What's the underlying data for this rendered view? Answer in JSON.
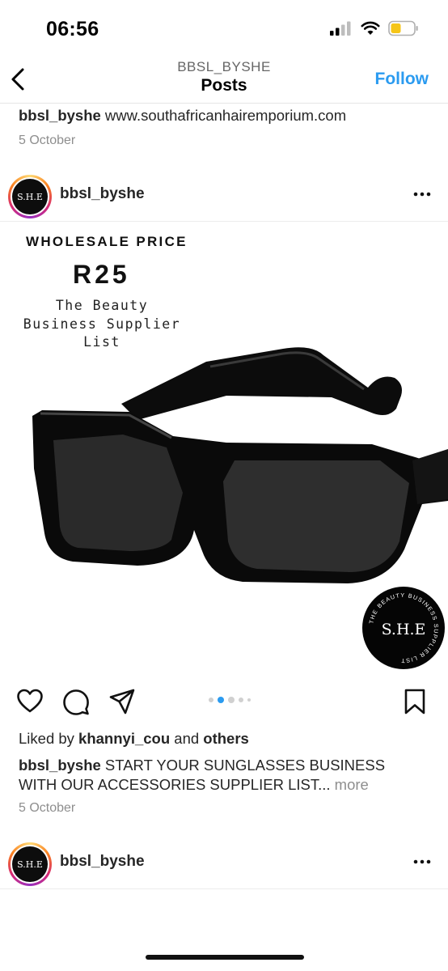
{
  "status_bar": {
    "time": "06:56"
  },
  "header": {
    "username": "BBSL_BYSHE",
    "title": "Posts",
    "follow_label": "Follow"
  },
  "previous_post": {
    "caption_user": "bbsl_byshe",
    "caption_text": " www.southafricanhairemporium.com",
    "date": "5 October"
  },
  "post": {
    "username": "bbsl_byshe",
    "avatar_text": "S.H.E",
    "image": {
      "heading": "WHOLESALE PRICE",
      "price": "R25",
      "tagline_lines": [
        "The Beauty",
        "Business Supplier",
        "List"
      ],
      "seal_text": "S.H.E",
      "seal_ring_text": "THE BEAUTY BUSINESS SUPPLIER LIST"
    },
    "carousel": {
      "count": 5,
      "active_index": 1
    },
    "likes_prefix": "Liked by ",
    "likes_user": "khannyi_cou",
    "likes_middle": " and ",
    "likes_others": "others",
    "caption_user": "bbsl_byshe",
    "caption_text": " START YOUR SUNGLASSES BUSINESS WITH OUR ACCESSORIES SUPPLIER LIST...",
    "caption_more": " more",
    "date": "5 October"
  },
  "next_post": {
    "username": "bbsl_byshe",
    "avatar_text": "S.H.E"
  },
  "icons": {
    "back": "chevron-left-icon",
    "more": "more-horizontal-icon",
    "like": "heart-icon",
    "comment": "comment-icon",
    "share": "paper-plane-icon",
    "save": "bookmark-icon"
  },
  "colors": {
    "accent": "#2b9bf0",
    "text": "#262626",
    "muted": "#8e8e8e"
  }
}
